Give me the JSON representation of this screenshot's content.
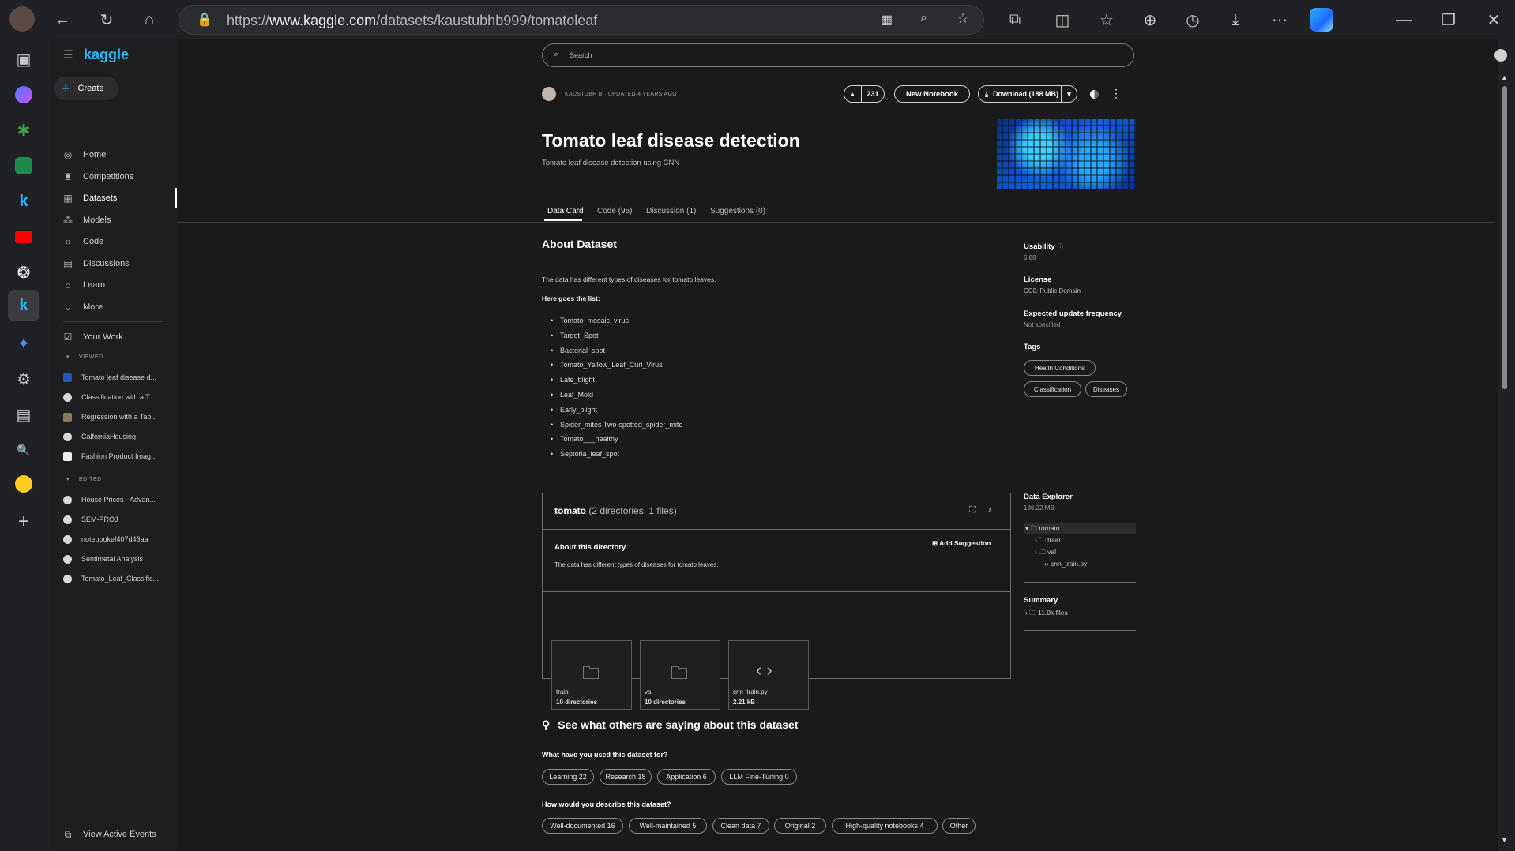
{
  "browser": {
    "url_prefix": "https://",
    "url_host": "www.kaggle.com",
    "url_path": "/datasets/kaustubhb999/tomatoleaf"
  },
  "sidebar": {
    "logo": "kaggle",
    "create": "Create",
    "nav": [
      {
        "label": "Home",
        "icon": "home-icon"
      },
      {
        "label": "Competitions",
        "icon": "trophy-icon"
      },
      {
        "label": "Datasets",
        "icon": "table-icon"
      },
      {
        "label": "Models",
        "icon": "models-icon"
      },
      {
        "label": "Code",
        "icon": "code-icon"
      },
      {
        "label": "Discussions",
        "icon": "discussion-icon"
      },
      {
        "label": "Learn",
        "icon": "learn-icon"
      },
      {
        "label": "More",
        "icon": "chevron-down-icon"
      }
    ],
    "your_work": "Your Work",
    "viewed_header": "VIEWED",
    "viewed": [
      "Tomato leaf disease d...",
      "Classification with a T...",
      "Regression with a Tab...",
      "CalforniaHousing",
      "Fashion Product Imag..."
    ],
    "edited_header": "EDITED",
    "edited": [
      "House Prices - Advan...",
      "SEM-PROJ",
      "notebookef407d43aa",
      "Sentimetal Analysis",
      "Tomato_Leaf_Classific..."
    ],
    "active_events": "View Active Events"
  },
  "search": {
    "placeholder": "Search"
  },
  "header": {
    "author_line": "KAUSTUBH B · UPDATED 4 YEARS AGO",
    "upvotes": "231",
    "new_notebook": "New Notebook",
    "download": "Download (188 MB)"
  },
  "dataset": {
    "title": "Tomato leaf disease detection",
    "subtitle": "Tomato leaf disease detection using CNN"
  },
  "tabs": [
    "Data Card",
    "Code (95)",
    "Discussion (1)",
    "Suggestions (0)"
  ],
  "about": {
    "heading": "About Dataset",
    "para": "The data has different types of diseases for tomato leaves.",
    "list_heading": "Here goes the list:",
    "items": [
      "Tomato_mosaic_virus",
      "Target_Spot",
      "Bacterial_spot",
      "Tomato_Yellow_Leaf_Curl_Virus",
      "Late_blight",
      "Leaf_Mold",
      "Early_blight",
      "Spider_mites Two-spotted_spider_mite",
      "Tomato___healthy",
      "Septoria_leaf_spot"
    ]
  },
  "meta": {
    "usability_label": "Usability",
    "usability_value": "6.88",
    "license_label": "License",
    "license_value": "CC0: Public Domain",
    "freq_label": "Expected update frequency",
    "freq_value": "Not specified",
    "tags_label": "Tags",
    "tags": [
      "Health Conditions",
      "Classification",
      "Diseases"
    ]
  },
  "directory": {
    "name": "tomato",
    "counts": "(2 directories, 1 files)",
    "about_heading": "About this directory",
    "add_suggestion": "Add Suggestion",
    "about_text": "The data has different types of diseases for tomato leaves.",
    "tiles": [
      {
        "name": "train",
        "sub": "10 directories",
        "icon": "folder-icon"
      },
      {
        "name": "val",
        "sub": "10 directories",
        "icon": "folder-icon"
      },
      {
        "name": "cnn_train.py",
        "sub": "2.21 kB",
        "icon": "code-icon"
      }
    ]
  },
  "explorer": {
    "heading": "Data Explorer",
    "size": "186.22 MB",
    "tree": [
      "tomato",
      "train",
      "val",
      "cnn_train.py"
    ],
    "summary_heading": "Summary",
    "summary_files": "11.0k files"
  },
  "others": {
    "heading": "See what others are saying about this dataset",
    "q1": "What have you used this dataset for?",
    "uses": [
      "Learning 22",
      "Research 18",
      "Application 6",
      "LLM Fine-Tuning 0"
    ],
    "q2": "How would you describe this dataset?",
    "describe": [
      "Well-documented 16",
      "Well-maintained 5",
      "Clean data 7",
      "Original 2",
      "High-quality notebooks 4",
      "Other"
    ]
  }
}
